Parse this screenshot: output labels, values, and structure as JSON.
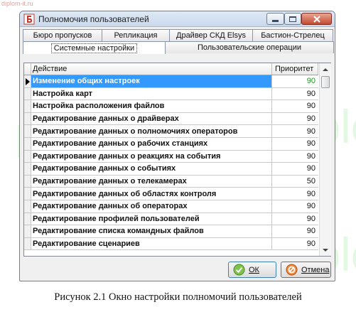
{
  "site_label": "diplom-it.ru",
  "watermark_text": "Diplom-it",
  "window": {
    "title": "Полномочия пользователей",
    "minimize_icon": "minimize-icon",
    "maximize_icon": "maximize-icon",
    "close_icon": "close-icon"
  },
  "tabs": {
    "row1": [
      {
        "label": "Бюро пропусков"
      },
      {
        "label": "Репликация"
      },
      {
        "label": "Драйвер СКД Elsys"
      },
      {
        "label": "Бастион-Стрелец"
      }
    ],
    "row2": [
      {
        "label": "Системные настройки",
        "active": true
      },
      {
        "label": "Пользовательские операции",
        "active": false
      }
    ]
  },
  "grid": {
    "columns": {
      "action": "Действие",
      "priority": "Приоритет"
    },
    "rows": [
      {
        "action": "Изменение общих настроек",
        "priority": "90",
        "selected": true
      },
      {
        "action": "Настройка карт",
        "priority": "90"
      },
      {
        "action": "Настройка расположения файлов",
        "priority": "90"
      },
      {
        "action": "Редактирование данных о драйверах",
        "priority": "90"
      },
      {
        "action": "Редактирование данных о полномочиях операторов",
        "priority": "90"
      },
      {
        "action": "Редактирование данных о рабочих станциях",
        "priority": "90"
      },
      {
        "action": "Редактирование данных о реакциях на события",
        "priority": "90"
      },
      {
        "action": "Редактирование данных о событиях",
        "priority": "90"
      },
      {
        "action": "Редактирование данных о телекамерах",
        "priority": "50"
      },
      {
        "action": "Редактирование данных об областях контроля",
        "priority": "90"
      },
      {
        "action": "Редактирование данных об операторах",
        "priority": "90"
      },
      {
        "action": "Редактирование профилей пользователей",
        "priority": "90"
      },
      {
        "action": "Редактирование списка командных файлов",
        "priority": "90"
      },
      {
        "action": "Редактирование сценариев",
        "priority": "90"
      }
    ]
  },
  "buttons": {
    "ok": {
      "label": "ОК",
      "icon": "checkmark-icon"
    },
    "cancel": {
      "label": "Отмена",
      "icon": "cancel-icon"
    }
  },
  "caption": "Рисунок 2.1 Окно настройки полномочий пользователей",
  "colors": {
    "selection": "#3399ff",
    "selected_priority": "#1a9a1a"
  }
}
